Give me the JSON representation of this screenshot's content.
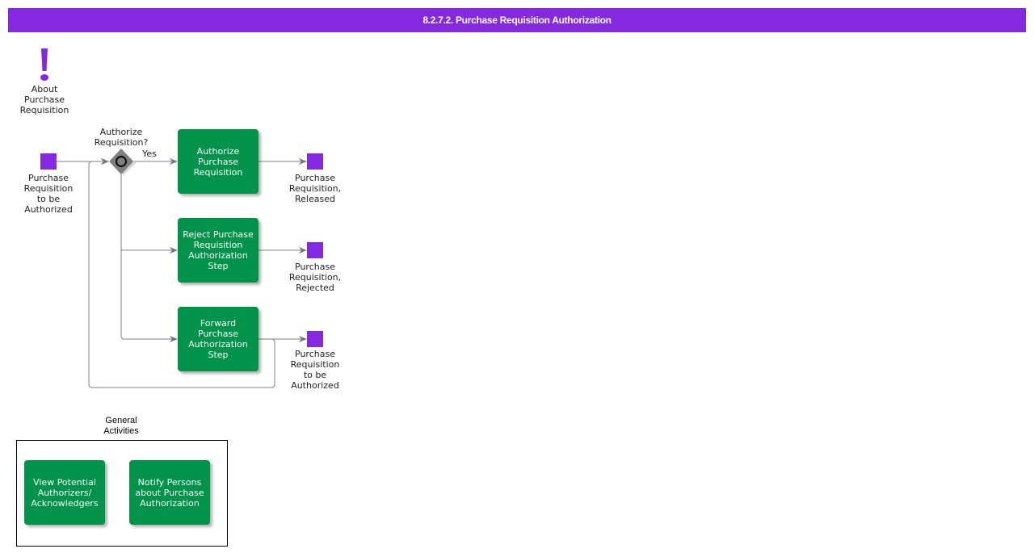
{
  "title": "8.2.7.2. Purchase Requisition Authorization",
  "colors": {
    "accent": "#8529e0",
    "task": "#009349",
    "gateway": "#808080"
  },
  "info": {
    "icon": "exclamation-icon",
    "label": "About\nPurchase\nRequisition"
  },
  "start_event": {
    "label": "Purchase\nRequisition\nto be\nAuthorized"
  },
  "gateway": {
    "label": "Authorize\nRequisition?",
    "yes_label": "Yes"
  },
  "tasks": [
    {
      "label": "Authorize\nPurchase\nRequisition"
    },
    {
      "label": "Reject Purchase\nRequisition\nAuthorization\nStep"
    },
    {
      "label": "Forward\nPurchase\nAuthorization\nStep"
    }
  ],
  "end_events": [
    {
      "label": "Purchase\nRequisition,\nReleased"
    },
    {
      "label": "Purchase\nRequisition,\nRejected"
    },
    {
      "label": "Purchase\nRequisition\nto be\nAuthorized"
    }
  ],
  "general": {
    "label": "General\nActivities",
    "tasks": [
      {
        "label": "View Potential\nAuthorizers/\nAcknowledgers"
      },
      {
        "label": "Notify Persons\nabout Purchase\nAuthorization"
      }
    ]
  }
}
